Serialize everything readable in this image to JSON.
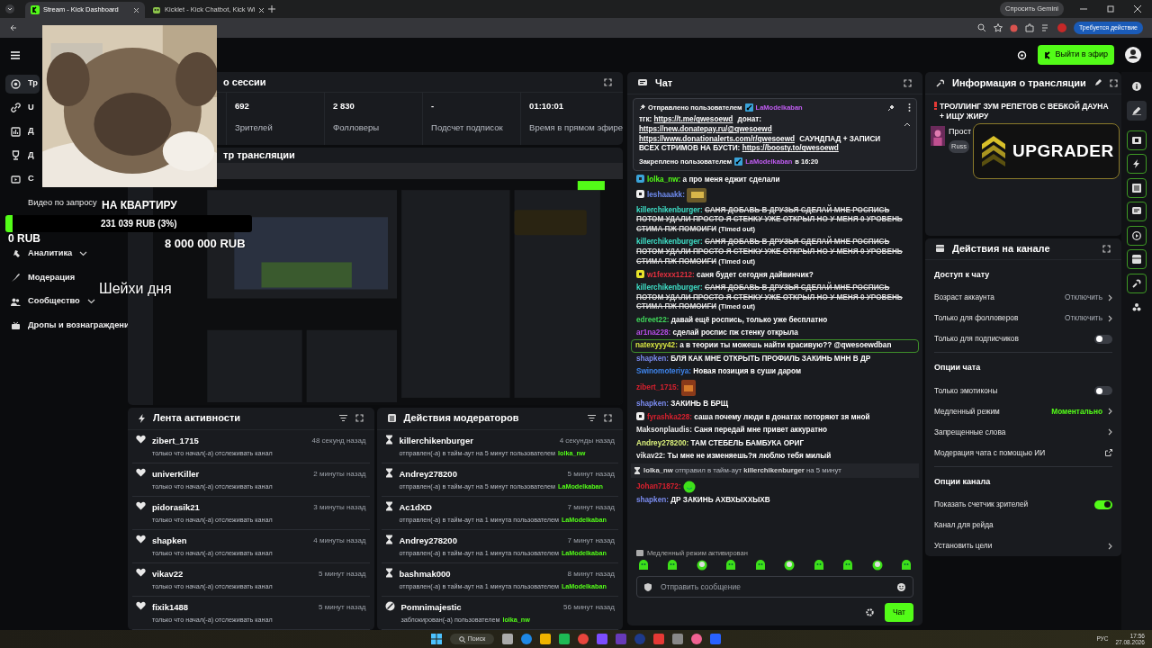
{
  "browser": {
    "tabs": [
      {
        "title": "Stream - Kick Dashboard",
        "selected": true
      },
      {
        "title": "Kicklet - Kick Chatbot, Kick Wi",
        "selected": false
      }
    ],
    "gemini": "Спросить Gemini",
    "action_required": "Требуется действие"
  },
  "header": {
    "go_live": "Выйти в эфир"
  },
  "sidebar": {
    "items": [
      {
        "label": "Тр",
        "kind": "item",
        "selected": true
      },
      {
        "label": "U",
        "kind": "item",
        "selected": false
      },
      {
        "label": "Д",
        "kind": "item",
        "selected": false
      },
      {
        "label": "Д",
        "kind": "item",
        "selected": false
      },
      {
        "label": "С",
        "kind": "item",
        "selected": false
      },
      {
        "label": "Видео по запросу",
        "kind": "subitem",
        "selected": false
      },
      {
        "label": "Аналитика",
        "kind": "group",
        "selected": false
      },
      {
        "label": "Модерация",
        "kind": "item",
        "selected": false
      },
      {
        "label": "Сообщество",
        "kind": "group",
        "selected": false
      },
      {
        "label": "Дропы и вознаграждени",
        "kind": "item",
        "selected": false
      }
    ]
  },
  "stream_overlay": {
    "goal_title": "НА КВАРТИРУ",
    "goal": {
      "progress": "231 039 RUB (3%)",
      "level": 0.03
    },
    "goal_start": "0 RUB",
    "goal_target": "8 000 000 RUB",
    "caption": "Шейхи дня",
    "banner": "UPGRADER"
  },
  "session": {
    "title": "о сессии",
    "stats": [
      {
        "value": "692",
        "label": "Зрителей"
      },
      {
        "value": "2 830",
        "label": "Фолловеры"
      },
      {
        "value": "-",
        "label": "Подсчет подписок"
      },
      {
        "value": "01:10:01",
        "label": "Время в прямом эфире"
      }
    ]
  },
  "preview": {
    "title": "тр трансляции"
  },
  "activity": {
    "title": "Лента активности",
    "items": [
      {
        "user": "zibert_1715",
        "time": "48 секунд назад",
        "text": "только что начал(-а) отслеживать канал"
      },
      {
        "user": "univerKiller",
        "time": "2 минуты назад",
        "text": "только что начал(-а) отслеживать канал"
      },
      {
        "user": "pidorasik21",
        "time": "3 минуты назад",
        "text": "только что начал(-а) отслеживать канал"
      },
      {
        "user": "shapken",
        "time": "4 минуты назад",
        "text": "только что начал(-а) отслеживать канал"
      },
      {
        "user": "vikav22",
        "time": "5 минут назад",
        "text": "только что начал(-а) отслеживать канал"
      },
      {
        "user": "fixik1488",
        "time": "5 минут назад",
        "text": "только что начал(-а) отслеживать канал"
      }
    ]
  },
  "mod_actions": {
    "title": "Действия модераторов",
    "items": [
      {
        "kind": "timeout",
        "user": "killerchikenburger",
        "time": "4 секунды назад",
        "text": "отправлен(-а) в тайм-аут на 5 минут пользователем",
        "by": "lolka_nw"
      },
      {
        "kind": "timeout",
        "user": "Andrey278200",
        "time": "5 минут назад",
        "text": "отправлен(-а) в тайм-аут на 5 минут пользователем",
        "by": "LaModelkaban"
      },
      {
        "kind": "timeout",
        "user": "Ac1dXD",
        "time": "7 минут назад",
        "text": "отправлен(-а) в тайм-аут на 1 минута пользователем",
        "by": "LaModelkaban"
      },
      {
        "kind": "timeout",
        "user": "Andrey278200",
        "time": "7 минут назад",
        "text": "отправлен(-а) в тайм-аут на 1 минута пользователем",
        "by": "LaModelkaban"
      },
      {
        "kind": "timeout",
        "user": "bashmak000",
        "time": "8 минут назад",
        "text": "отправлен(-а) в тайм-аут на 1 минута пользователем",
        "by": "LaModelkaban"
      },
      {
        "kind": "ban",
        "user": "Pomnimajestic",
        "time": "56 минут назад",
        "text": "заблокирован(-а) пользователем",
        "by": "lolka_nw"
      }
    ]
  },
  "chat": {
    "title": "Чат",
    "pinned": {
      "sent_label": "Отправлено пользователем",
      "sent_by": "LaModelkaban",
      "parts": [
        {
          "kind": "text",
          "text": "тгк: "
        },
        {
          "kind": "link",
          "text": "https://t.me/qwesoewd"
        },
        {
          "kind": "text",
          "text": " донат: "
        },
        {
          "kind": "link",
          "text": "https://new.donatepay.ru/@qwesoewd"
        },
        {
          "kind": "link",
          "text": "https://www.donationalerts.com/r/qwesoewd"
        },
        {
          "kind": "text",
          "text": " САУНДПАД + ЗАПИСИ ВСЕХ СТРИМОВ НА БУСТИ: "
        },
        {
          "kind": "link",
          "text": "https://boosty.to/qwesoewd"
        }
      ],
      "pinned_label": "Закреплено пользователем",
      "pinned_by": "LaModelkaban",
      "pinned_at": "в 16:20"
    },
    "messages": [
      {
        "kind": "message",
        "badge": {
          "color": "#3aa3d9"
        },
        "user": "lolka_nw:",
        "color": "#53fc18",
        "text": "а про меня еджит сделали",
        "deleted": false,
        "highlighted": false
      },
      {
        "kind": "emote",
        "badge": {
          "color": "#eeeeee"
        },
        "user": "leshaaakk:",
        "color": "#6f8cf0"
      },
      {
        "kind": "message",
        "user": "killerchikenburger:",
        "color": "#3ee0c8",
        "text": "САНЯ ДОБАВЬ В ДРУЗЬЯ СДЕЛАЙ МНЕ РОСПИСЬ ПОТОМ УДАЛИ ПРОСТО Я СТЕНКУ УЖЕ ОТКРЫЛ НО У МЕНЯ 0 УРОВЕНЬ СТИМА ПЖ ПОМОИГИ",
        "note": "(Timed out)",
        "deleted": true,
        "highlighted": false
      },
      {
        "kind": "message",
        "user": "killerchikenburger:",
        "color": "#3ee0c8",
        "text": "САНЯ ДОБАВЬ В ДРУЗЬЯ СДЕЛАЙ МНЕ РОСПИСЬ ПОТОМ УДАЛИ ПРОСТО Я СТЕНКУ УЖЕ ОТКРЫЛ НО У МЕНЯ 0 УРОВЕНЬ СТИМА ПЖ ПОМОИГИ",
        "note": "(Timed out)",
        "deleted": true,
        "highlighted": false
      },
      {
        "kind": "message",
        "badge": {
          "color": "#e6e22a"
        },
        "user": "w1fexxx1212:",
        "color": "#e3303f",
        "text": "саня будет сегодня дайвинчик?",
        "deleted": false,
        "highlighted": false
      },
      {
        "kind": "message",
        "user": "killerchikenburger:",
        "color": "#3ee0c8",
        "text": "САНЯ ДОБАВЬ В ДРУЗЬЯ СДЕЛАЙ МНЕ РОСПИСЬ ПОТОМ УДАЛИ ПРОСТО Я СТЕНКУ УЖЕ ОТКРЫЛ НО У МЕНЯ 0 УРОВЕНЬ СТИМА ПЖ ПОМОИГИ",
        "note": "(Timed out)",
        "deleted": true,
        "highlighted": false
      },
      {
        "kind": "message",
        "user": "edreet22:",
        "color": "#3fd65a",
        "text": "давай ещё роспись, только уже бесплатно",
        "deleted": false,
        "highlighted": false
      },
      {
        "kind": "message",
        "user": "ar1na228:",
        "color": "#b64de6",
        "text": "сделай роспис пж стенку открыла",
        "deleted": false,
        "highlighted": false
      },
      {
        "kind": "message",
        "user": "natexyyy42:",
        "color": "#d8e642",
        "text": "а в теории ты можешь найти красивую?? @qwesoewdban",
        "deleted": false,
        "highlighted": true
      },
      {
        "kind": "message",
        "user": "shapken:",
        "color": "#7b8cf0",
        "text": "БЛЯ КАК МНЕ ОТКРЫТЬ ПРОФИЛЬ ЗАКИНЬ МНН В ДР",
        "deleted": false,
        "highlighted": false
      },
      {
        "kind": "message",
        "user": "Swinomoteriya:",
        "color": "#3f86ef",
        "text": "Новая позиция в суши даром",
        "deleted": false,
        "highlighted": false
      },
      {
        "kind": "emote",
        "user": "zibert_1715:",
        "color": "#d8202e"
      },
      {
        "kind": "message",
        "user": "shapken:",
        "color": "#7b8cf0",
        "text": "ЗАКИНЬ В БРЩ",
        "deleted": false,
        "highlighted": false
      },
      {
        "kind": "message",
        "badge": {
          "color": "#eeeeee"
        },
        "user": "fyrashka228:",
        "color": "#d8202e",
        "text": "саша почему люди в донатах поторяют зя мной",
        "deleted": false,
        "highlighted": false
      },
      {
        "kind": "message",
        "user": "Maksonplaudis:",
        "color": "#e8e8e8",
        "text": "Саня передай мне привет аккуратно",
        "deleted": false,
        "highlighted": false
      },
      {
        "kind": "message",
        "user": "Andrey278200:",
        "color": "#dcf27c",
        "text": "ТАМ СТЕБЕЛЬ БАМБУКА ОРИГ",
        "deleted": false,
        "highlighted": false
      },
      {
        "kind": "message",
        "user": "vikav22:",
        "color": "#e8e8e8",
        "text": "Ты мне не изменяешь?я люблю тебя милый",
        "deleted": false,
        "highlighted": false
      },
      {
        "kind": "system",
        "text": "**lolka_nw** отправил в тайм-аут **killerchikenburger** на 5 минут"
      },
      {
        "kind": "emote",
        "user": "Johan71872:",
        "color": "#d8202e"
      },
      {
        "kind": "message",
        "user": "shapken:",
        "color": "#7b8cf0",
        "text": "ДР ЗАКИНЬ АХВХЫХХЫХВ",
        "deleted": false,
        "highlighted": false
      }
    ],
    "slow_mode": "Медленный режим активирован",
    "placeholder": "Отправить сообщение",
    "send": "Чат"
  },
  "stream_info": {
    "title": "Информация о трансляции",
    "stream_title": "ТРОЛЛИНГ ЗУМ РЕПЕТОВ С ВЕБКОЙ ДАУНА + ИЩУ ЖИРУ",
    "category": "Прост",
    "tag": "Russ"
  },
  "channel_actions": {
    "title": "Действия на канале",
    "sections": [
      {
        "title": "Доступ к чату",
        "rows": [
          {
            "kind": "select",
            "label": "Возраст аккаунта",
            "value": "Отключить",
            "active": false
          },
          {
            "kind": "select",
            "label": "Только для фолловеров",
            "value": "Отключить",
            "active": false
          },
          {
            "kind": "toggle",
            "label": "Только для подписчиков",
            "on": false
          }
        ]
      },
      {
        "title": "Опции чата",
        "rows": [
          {
            "kind": "toggle",
            "label": "Только эмотиконы",
            "on": false
          },
          {
            "kind": "select",
            "label": "Медленный режим",
            "value": "Моментально",
            "active": true
          },
          {
            "kind": "link",
            "label": "Запрещенные слова"
          },
          {
            "kind": "external",
            "label": "Модерация чата с помощью ИИ"
          }
        ]
      },
      {
        "title": "Опции канала",
        "rows": [
          {
            "kind": "toggle",
            "label": "Показать счетчик зрителей",
            "on": true
          },
          {
            "kind": "plain",
            "label": "Канал для рейда"
          },
          {
            "kind": "link",
            "label": "Установить цели"
          }
        ]
      }
    ]
  },
  "rail": [
    {
      "active": false,
      "selected": false
    },
    {
      "active": false,
      "selected": true
    },
    {
      "active": true,
      "selected": false
    },
    {
      "active": true,
      "selected": false
    },
    {
      "active": true,
      "selected": false
    },
    {
      "active": true,
      "selected": false
    },
    {
      "active": true,
      "selected": false
    },
    {
      "active": true,
      "selected": false
    },
    {
      "active": true,
      "selected": false
    },
    {
      "active": false,
      "selected": false
    }
  ],
  "taskbar": {
    "search": "Поиск",
    "language": "РУС",
    "time": "17:56",
    "date": "27.08.2026"
  }
}
